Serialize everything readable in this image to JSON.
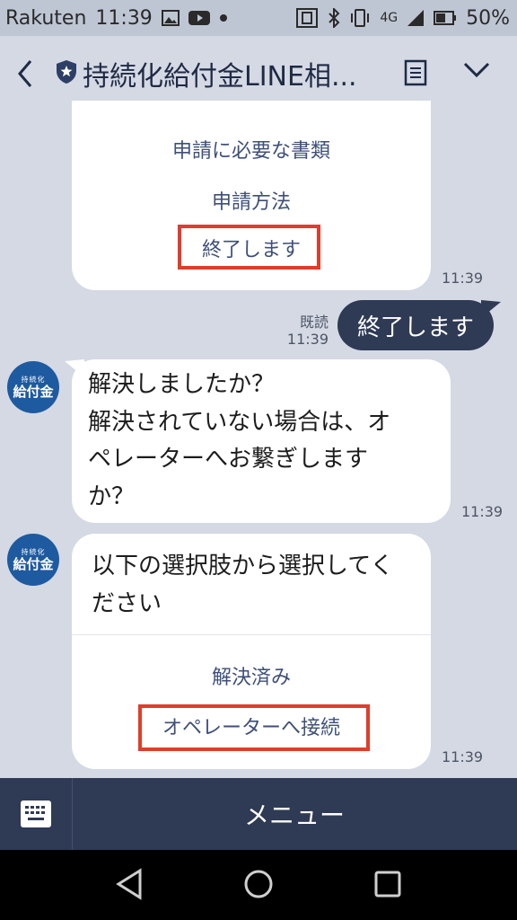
{
  "statusbar": {
    "carrier": "Rakuten",
    "time": "11:39",
    "network": "4G",
    "battery": "50%"
  },
  "header": {
    "title": "持続化給付金LINE相..."
  },
  "messages": {
    "menu_card_options": [
      "申請に必要な書類",
      "申請方法",
      "終了します"
    ],
    "menu_card_time": "11:39",
    "sent_read_label": "既読",
    "sent_time": "11:39",
    "sent_text": "終了します",
    "bot_question_lines": [
      "解決しましたか？",
      "解決されていない場合は、オ",
      "ペレーターへお繋ぎします",
      "か？"
    ],
    "bot_question_time": "11:39",
    "choice_prompt_lines": [
      "以下の選択肢から選択してく",
      "ださい"
    ],
    "choice_options": [
      "解決済み",
      "オペレーターへ接続"
    ],
    "choice_time": "11:39"
  },
  "avatar": {
    "top_text": "持続化",
    "main_text": "給付金"
  },
  "menu": {
    "label": "メニュー"
  },
  "colors": {
    "background": "#d4d9e4",
    "navy": "#2f3a55",
    "highlight": "#e23c2c",
    "link": "#3e4f79",
    "avatar": "#1e5aa0"
  }
}
